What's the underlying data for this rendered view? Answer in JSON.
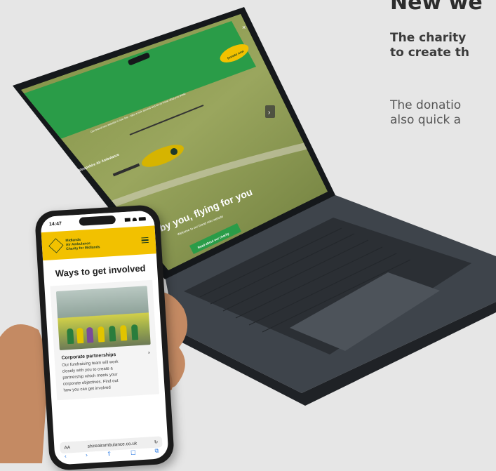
{
  "side": {
    "heading": "New we",
    "lead_lines": [
      "The charity",
      "to create th"
    ],
    "body_lines": [
      "The donatio",
      "also quick a"
    ]
  },
  "laptop": {
    "banner": "Our brand new website is now live - take a look around and let us know what you think!",
    "donate_label": "Donate now",
    "close_icon": "×",
    "logo_text": "Shropshire Air Ambulance",
    "hero_title": "by you, flying for you",
    "hero_sub": "Welcome to our brand new website",
    "cta_label": "Read about our charity",
    "next_icon": "›"
  },
  "phone": {
    "time": "14:47",
    "logo_lines": [
      "Midlands",
      "Air Ambulance",
      "Charity for Midlands"
    ],
    "page_title": "Ways to get involved",
    "card_title": "Corporate partnerships",
    "card_arrow": "›",
    "card_text": [
      "Our fundraising team will work",
      "closely with you to create a",
      "partnership which meets your",
      "corporate objectives. Find out",
      "how you can get involved"
    ],
    "url_left": "AA",
    "url": "shireairambulance.co.uk",
    "reload_icon": "↻",
    "toolbar": [
      "‹",
      "›",
      "⇧",
      "□",
      "⧉"
    ]
  },
  "colors": {
    "green": "#2a9c48",
    "yellow": "#f2c100",
    "body_text": "#555555"
  }
}
